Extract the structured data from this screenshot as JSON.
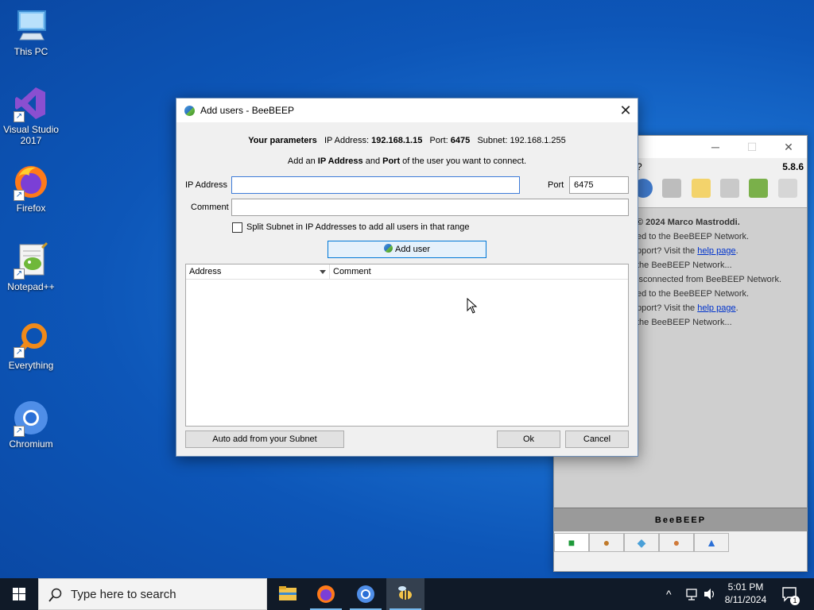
{
  "desktop": {
    "icons": [
      {
        "label": "This PC"
      },
      {
        "label": "Visual Studio 2017"
      },
      {
        "label": "Firefox"
      },
      {
        "label": "Notepad++"
      },
      {
        "label": "Everything"
      },
      {
        "label": "Chromium"
      }
    ]
  },
  "back_window": {
    "version": "5.8.6",
    "q_text": "?",
    "brand": "BeeBEEP",
    "log": [
      {
        "text": "© 2024 Marco Mastroddi.",
        "bold": true
      },
      {
        "text": "ed to the BeeBEEP Network."
      },
      {
        "pre": "pport? Visit the ",
        "link": "help page",
        "post": "."
      },
      {
        "text": "the BeeBEEP Network..."
      },
      {
        "text": "isconnected from BeeBEEP Network."
      },
      {
        "text": "ed to the BeeBEEP Network."
      },
      {
        "pre": "pport? Visit the ",
        "link": "help page",
        "post": "."
      },
      {
        "text": "the BeeBEEP Network..."
      }
    ]
  },
  "dialog": {
    "title": "Add users - BeeBEEP",
    "params": {
      "label": "Your parameters",
      "ip_label": "IP Address:",
      "ip": "192.168.1.15",
      "port_label": "Port:",
      "port": "6475",
      "subnet_label": "Subnet:",
      "subnet": "192.168.1.255"
    },
    "instruction": {
      "pre": "Add an ",
      "b1": "IP Address",
      "mid": " and ",
      "b2": "Port",
      "post": " of the user you want to connect."
    },
    "ip_field": {
      "label": "IP Address",
      "value": ""
    },
    "port_field": {
      "label": "Port",
      "value": "6475"
    },
    "comment_field": {
      "label": "Comment",
      "value": ""
    },
    "split_subnet": {
      "label": "Split Subnet in IP Addresses to add all users in that range",
      "checked": false
    },
    "add_user_label": "Add user",
    "table": {
      "columns": [
        "Address",
        "Comment"
      ],
      "rows": []
    },
    "auto_add_label": "Auto add from your Subnet",
    "ok_label": "Ok",
    "cancel_label": "Cancel"
  },
  "taskbar": {
    "search_placeholder": "Type here to search",
    "time": "5:01 PM",
    "date": "8/11/2024",
    "notifications": "1"
  }
}
